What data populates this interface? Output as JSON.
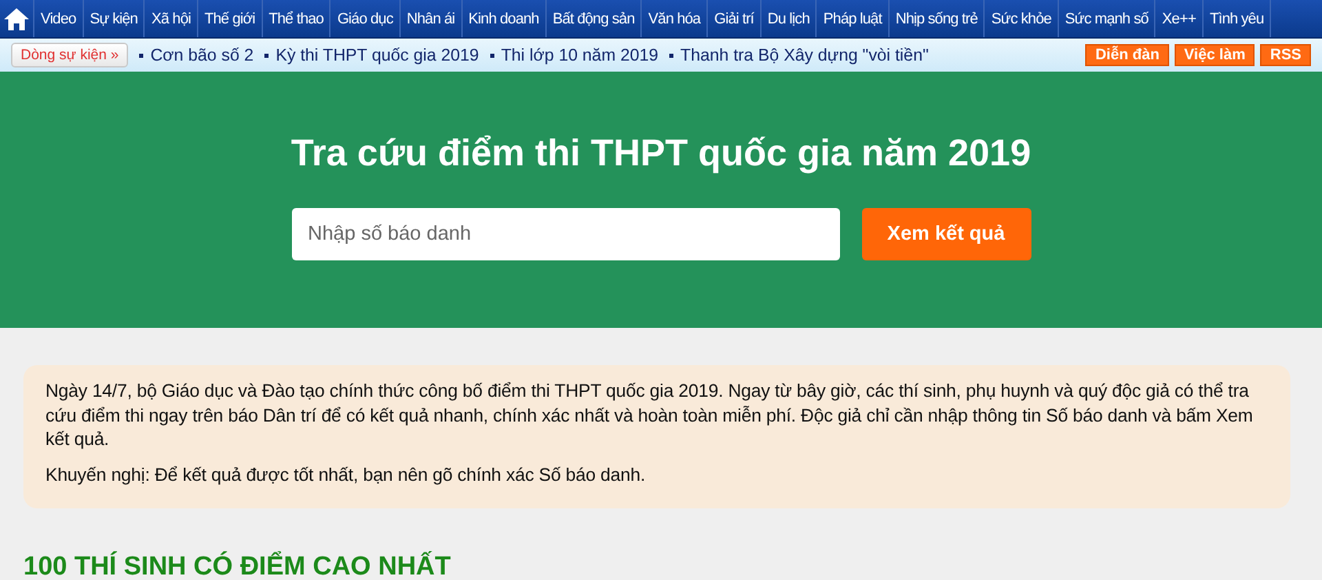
{
  "nav": {
    "items": [
      {
        "label": "Video"
      },
      {
        "label": "Sự kiện"
      },
      {
        "label": "Xã hội"
      },
      {
        "label": "Thế giới"
      },
      {
        "label": "Thể thao"
      },
      {
        "label": "Giáo dục"
      },
      {
        "label": "Nhân ái"
      },
      {
        "label": "Kinh doanh"
      },
      {
        "label": "Bất động sản"
      },
      {
        "label": "Văn hóa"
      },
      {
        "label": "Giải trí"
      },
      {
        "label": "Du lịch"
      },
      {
        "label": "Pháp luật"
      },
      {
        "label": "Nhịp sống trẻ"
      },
      {
        "label": "Sức khỏe"
      },
      {
        "label": "Sức mạnh số"
      },
      {
        "label": "Xe++"
      },
      {
        "label": "Tình yêu"
      }
    ]
  },
  "events": {
    "badge": "Dòng sự kiện »",
    "items": [
      "Cơn bão số 2",
      "Kỳ thi THPT quốc gia 2019",
      "Thi lớp 10 năm 2019",
      "Thanh tra Bộ Xây dựng \"vòi tiền\""
    ],
    "links": [
      "Diễn đàn",
      "Việc làm",
      "RSS"
    ]
  },
  "hero": {
    "title": "Tra cứu điểm thi THPT quốc gia năm 2019",
    "search": {
      "placeholder": "Nhập số báo danh"
    },
    "button": "Xem kết quả"
  },
  "notice": {
    "paragraphs": [
      "Ngày 14/7, bộ Giáo dục và Đào tạo chính thức công bố điểm thi THPT quốc gia 2019. Ngay từ bây giờ, các thí sinh, phụ huynh và quý độc giả có thể tra cứu điểm thi ngay trên báo Dân trí để có kết quả nhanh, chính xác nhất và hoàn toàn miễn phí. Độc giả chỉ cần nhập thông tin Số báo danh và bấm Xem kết quả.",
      "Khuyến nghị: Để kết quả được tốt nhất, bạn nên gõ chính xác Số báo danh."
    ]
  },
  "section_title": "100 THÍ SINH CÓ ĐIỂM CAO NHẤT"
}
